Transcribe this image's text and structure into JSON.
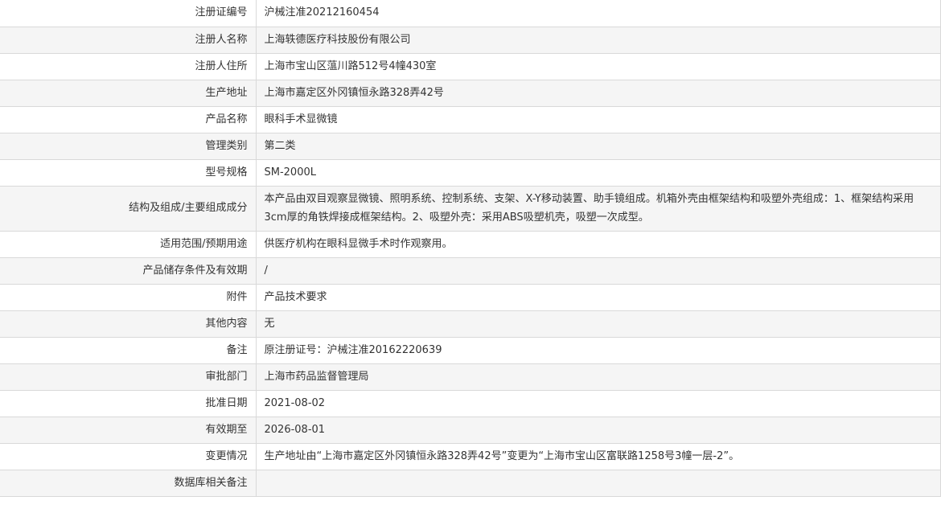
{
  "rows": [
    {
      "label": "注册证编号",
      "value": "沪械注准20212160454"
    },
    {
      "label": "注册人名称",
      "value": "上海轶德医疗科技股份有限公司"
    },
    {
      "label": "注册人住所",
      "value": "上海市宝山区蕰川路512号4幢430室"
    },
    {
      "label": "生产地址",
      "value": "上海市嘉定区外冈镇恒永路328弄42号"
    },
    {
      "label": "产品名称",
      "value": "眼科手术显微镜"
    },
    {
      "label": "管理类别",
      "value": "第二类"
    },
    {
      "label": "型号规格",
      "value": "SM-2000L"
    },
    {
      "label": "结构及组成/主要组成成分",
      "value": "本产品由双目观察显微镜、照明系统、控制系统、支架、X-Y移动装置、助手镜组成。机箱外壳由框架结构和吸塑外壳组成：1、框架结构采用3cm厚的角铁焊接成框架结构。2、吸塑外壳：采用ABS吸塑机壳，吸塑一次成型。"
    },
    {
      "label": "适用范围/预期用途",
      "value": "供医疗机构在眼科显微手术时作观察用。"
    },
    {
      "label": "产品储存条件及有效期",
      "value": "/"
    },
    {
      "label": "附件",
      "value": "产品技术要求"
    },
    {
      "label": "其他内容",
      "value": "无"
    },
    {
      "label": "备注",
      "value": "原注册证号：沪械注准20162220639"
    },
    {
      "label": "审批部门",
      "value": "上海市药品监督管理局"
    },
    {
      "label": "批准日期",
      "value": "2021-08-02"
    },
    {
      "label": "有效期至",
      "value": "2026-08-01"
    },
    {
      "label": "变更情况",
      "value": "生产地址由“上海市嘉定区外冈镇恒永路328弄42号”变更为“上海市宝山区富联路1258号3幢一层-2”。"
    },
    {
      "label": "数据库相关备注",
      "value": ""
    }
  ]
}
